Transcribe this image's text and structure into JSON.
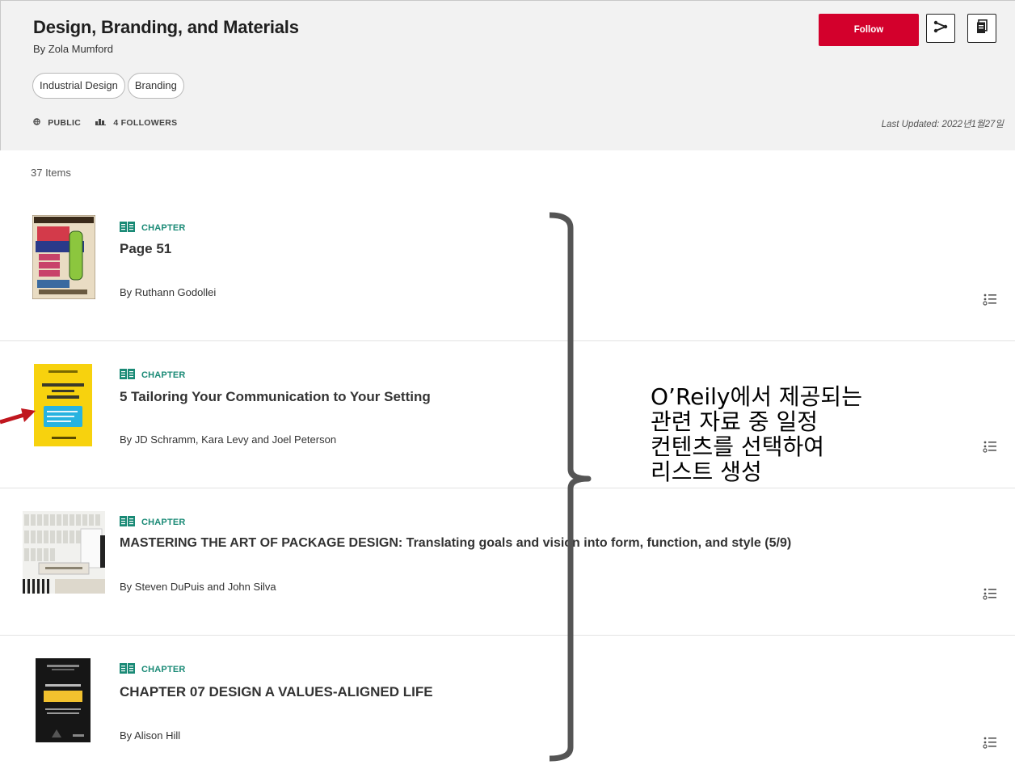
{
  "header": {
    "title": "Design, Branding, and Materials",
    "author": "By Zola Mumford",
    "tags": [
      "Industrial Design",
      "Branding"
    ],
    "visibility": "PUBLIC",
    "followers": "4 FOLLOWERS",
    "last_updated": "Last Updated: 2022년1월27일",
    "follow_label": "Follow",
    "icons": [
      "share-icon",
      "copy-icon",
      "globe-icon",
      "followers-icon"
    ]
  },
  "list": {
    "count_label": "37 Items",
    "items": [
      {
        "type": "CHAPTER",
        "title": "Page 51",
        "author": "By Ruthann Godollei",
        "cover": "gig-posters-cover"
      },
      {
        "type": "CHAPTER",
        "title": "5 Tailoring Your Communication to Your Setting",
        "author": "By JD Schramm, Kara Levy and Joel Peterson",
        "cover": "communicate-with-mastery-cover"
      },
      {
        "type": "CHAPTER",
        "title": "MASTERING THE ART OF PACKAGE DESIGN: Translating goals and vision into form, function, and style (5/9)",
        "author": "By Steven DuPuis and John Silva",
        "cover": "package-design-workbook-cover"
      },
      {
        "type": "CHAPTER",
        "title": "CHAPTER 07 DESIGN A VALUES-ALIGNED LIFE",
        "author": "By Alison Hill",
        "cover": "stand-out-cover"
      }
    ]
  },
  "annotation": {
    "text": "O’Reily에서 제공되는\n관련 자료 중 일정\n컨텐츠를 선택하여\n리스트 생성",
    "bracket_color": "#555555",
    "arrow_color": "#c0161e"
  },
  "colors": {
    "accent": "#d3002c",
    "chapter": "#1a8a76",
    "header_bg": "#f2f2f2"
  }
}
